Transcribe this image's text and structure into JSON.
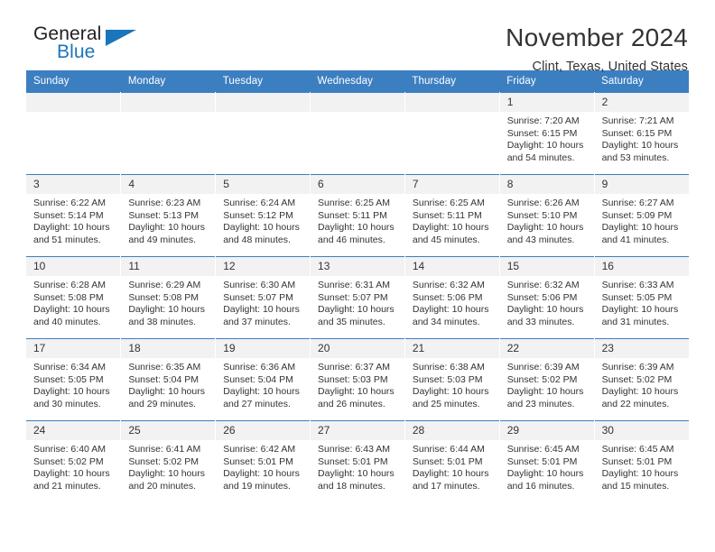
{
  "brand": {
    "name_part1": "General",
    "name_part2": "Blue",
    "accent_color": "#1b75bb"
  },
  "header": {
    "title": "November 2024",
    "subtitle": "Clint, Texas, United States"
  },
  "theme": {
    "header_row_bg": "#3c7fc1",
    "daynum_bg": "#f2f2f2",
    "text_color": "#333333"
  },
  "calendar": {
    "weekday_headers": [
      "Sunday",
      "Monday",
      "Tuesday",
      "Wednesday",
      "Thursday",
      "Friday",
      "Saturday"
    ],
    "weeks": [
      [
        {
          "day": "",
          "sunrise": "",
          "sunset": "",
          "daylight": "",
          "empty": true
        },
        {
          "day": "",
          "sunrise": "",
          "sunset": "",
          "daylight": "",
          "empty": true
        },
        {
          "day": "",
          "sunrise": "",
          "sunset": "",
          "daylight": "",
          "empty": true
        },
        {
          "day": "",
          "sunrise": "",
          "sunset": "",
          "daylight": "",
          "empty": true
        },
        {
          "day": "",
          "sunrise": "",
          "sunset": "",
          "daylight": "",
          "empty": true
        },
        {
          "day": "1",
          "sunrise": "Sunrise: 7:20 AM",
          "sunset": "Sunset: 6:15 PM",
          "daylight": "Daylight: 10 hours and 54 minutes."
        },
        {
          "day": "2",
          "sunrise": "Sunrise: 7:21 AM",
          "sunset": "Sunset: 6:15 PM",
          "daylight": "Daylight: 10 hours and 53 minutes."
        }
      ],
      [
        {
          "day": "3",
          "sunrise": "Sunrise: 6:22 AM",
          "sunset": "Sunset: 5:14 PM",
          "daylight": "Daylight: 10 hours and 51 minutes."
        },
        {
          "day": "4",
          "sunrise": "Sunrise: 6:23 AM",
          "sunset": "Sunset: 5:13 PM",
          "daylight": "Daylight: 10 hours and 49 minutes."
        },
        {
          "day": "5",
          "sunrise": "Sunrise: 6:24 AM",
          "sunset": "Sunset: 5:12 PM",
          "daylight": "Daylight: 10 hours and 48 minutes."
        },
        {
          "day": "6",
          "sunrise": "Sunrise: 6:25 AM",
          "sunset": "Sunset: 5:11 PM",
          "daylight": "Daylight: 10 hours and 46 minutes."
        },
        {
          "day": "7",
          "sunrise": "Sunrise: 6:25 AM",
          "sunset": "Sunset: 5:11 PM",
          "daylight": "Daylight: 10 hours and 45 minutes."
        },
        {
          "day": "8",
          "sunrise": "Sunrise: 6:26 AM",
          "sunset": "Sunset: 5:10 PM",
          "daylight": "Daylight: 10 hours and 43 minutes."
        },
        {
          "day": "9",
          "sunrise": "Sunrise: 6:27 AM",
          "sunset": "Sunset: 5:09 PM",
          "daylight": "Daylight: 10 hours and 41 minutes."
        }
      ],
      [
        {
          "day": "10",
          "sunrise": "Sunrise: 6:28 AM",
          "sunset": "Sunset: 5:08 PM",
          "daylight": "Daylight: 10 hours and 40 minutes."
        },
        {
          "day": "11",
          "sunrise": "Sunrise: 6:29 AM",
          "sunset": "Sunset: 5:08 PM",
          "daylight": "Daylight: 10 hours and 38 minutes."
        },
        {
          "day": "12",
          "sunrise": "Sunrise: 6:30 AM",
          "sunset": "Sunset: 5:07 PM",
          "daylight": "Daylight: 10 hours and 37 minutes."
        },
        {
          "day": "13",
          "sunrise": "Sunrise: 6:31 AM",
          "sunset": "Sunset: 5:07 PM",
          "daylight": "Daylight: 10 hours and 35 minutes."
        },
        {
          "day": "14",
          "sunrise": "Sunrise: 6:32 AM",
          "sunset": "Sunset: 5:06 PM",
          "daylight": "Daylight: 10 hours and 34 minutes."
        },
        {
          "day": "15",
          "sunrise": "Sunrise: 6:32 AM",
          "sunset": "Sunset: 5:06 PM",
          "daylight": "Daylight: 10 hours and 33 minutes."
        },
        {
          "day": "16",
          "sunrise": "Sunrise: 6:33 AM",
          "sunset": "Sunset: 5:05 PM",
          "daylight": "Daylight: 10 hours and 31 minutes."
        }
      ],
      [
        {
          "day": "17",
          "sunrise": "Sunrise: 6:34 AM",
          "sunset": "Sunset: 5:05 PM",
          "daylight": "Daylight: 10 hours and 30 minutes."
        },
        {
          "day": "18",
          "sunrise": "Sunrise: 6:35 AM",
          "sunset": "Sunset: 5:04 PM",
          "daylight": "Daylight: 10 hours and 29 minutes."
        },
        {
          "day": "19",
          "sunrise": "Sunrise: 6:36 AM",
          "sunset": "Sunset: 5:04 PM",
          "daylight": "Daylight: 10 hours and 27 minutes."
        },
        {
          "day": "20",
          "sunrise": "Sunrise: 6:37 AM",
          "sunset": "Sunset: 5:03 PM",
          "daylight": "Daylight: 10 hours and 26 minutes."
        },
        {
          "day": "21",
          "sunrise": "Sunrise: 6:38 AM",
          "sunset": "Sunset: 5:03 PM",
          "daylight": "Daylight: 10 hours and 25 minutes."
        },
        {
          "day": "22",
          "sunrise": "Sunrise: 6:39 AM",
          "sunset": "Sunset: 5:02 PM",
          "daylight": "Daylight: 10 hours and 23 minutes."
        },
        {
          "day": "23",
          "sunrise": "Sunrise: 6:39 AM",
          "sunset": "Sunset: 5:02 PM",
          "daylight": "Daylight: 10 hours and 22 minutes."
        }
      ],
      [
        {
          "day": "24",
          "sunrise": "Sunrise: 6:40 AM",
          "sunset": "Sunset: 5:02 PM",
          "daylight": "Daylight: 10 hours and 21 minutes."
        },
        {
          "day": "25",
          "sunrise": "Sunrise: 6:41 AM",
          "sunset": "Sunset: 5:02 PM",
          "daylight": "Daylight: 10 hours and 20 minutes."
        },
        {
          "day": "26",
          "sunrise": "Sunrise: 6:42 AM",
          "sunset": "Sunset: 5:01 PM",
          "daylight": "Daylight: 10 hours and 19 minutes."
        },
        {
          "day": "27",
          "sunrise": "Sunrise: 6:43 AM",
          "sunset": "Sunset: 5:01 PM",
          "daylight": "Daylight: 10 hours and 18 minutes."
        },
        {
          "day": "28",
          "sunrise": "Sunrise: 6:44 AM",
          "sunset": "Sunset: 5:01 PM",
          "daylight": "Daylight: 10 hours and 17 minutes."
        },
        {
          "day": "29",
          "sunrise": "Sunrise: 6:45 AM",
          "sunset": "Sunset: 5:01 PM",
          "daylight": "Daylight: 10 hours and 16 minutes."
        },
        {
          "day": "30",
          "sunrise": "Sunrise: 6:45 AM",
          "sunset": "Sunset: 5:01 PM",
          "daylight": "Daylight: 10 hours and 15 minutes."
        }
      ]
    ]
  }
}
